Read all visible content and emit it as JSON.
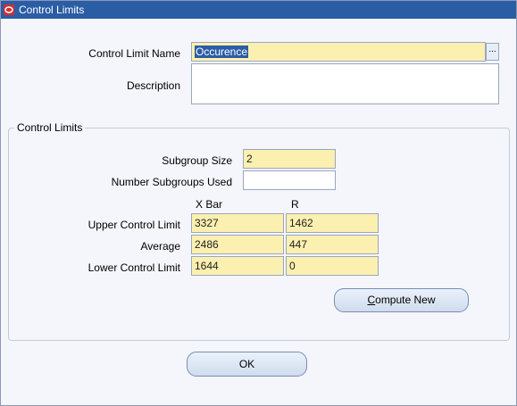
{
  "window": {
    "title": "Control Limits"
  },
  "form": {
    "name_label": "Control Limit Name",
    "name_value": "Occurence",
    "lov_label": "...",
    "description_label": "Description",
    "description_value": ""
  },
  "limits": {
    "group_title": "Control Limits",
    "subgroup_size_label": "Subgroup Size",
    "subgroup_size_value": "2",
    "num_subgroups_label": "Number Subgroups Used",
    "num_subgroups_value": "",
    "col_xbar": "X Bar",
    "col_r": "R",
    "rows": [
      {
        "label": "Upper Control Limit",
        "xbar": "3327",
        "r": "1462"
      },
      {
        "label": "Average",
        "xbar": "2486",
        "r": "447"
      },
      {
        "label": "Lower Control Limit",
        "xbar": "1644",
        "r": "0"
      }
    ],
    "compute_first": "C",
    "compute_rest": "ompute New"
  },
  "buttons": {
    "ok": "OK"
  },
  "colors": {
    "titlebar": "#2b5da5",
    "field_bg": "#fcf0b0",
    "window_bg": "#f4f6fb"
  }
}
